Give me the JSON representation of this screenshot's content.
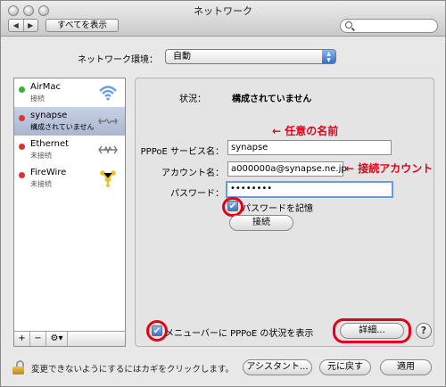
{
  "window": {
    "title": "ネットワーク",
    "nav_back": "◀",
    "nav_forward": "▶",
    "show_all": "すべてを表示",
    "search_placeholder": ""
  },
  "location": {
    "label": "ネットワーク環境：",
    "value": "自動"
  },
  "services": [
    {
      "name": "AirMac",
      "status": "接続",
      "status_color": "#2fb52f",
      "icon": "wifi-icon"
    },
    {
      "name": "synapse",
      "status": "構成されていません",
      "status_color": "#e03030",
      "icon": "ppp-icon"
    },
    {
      "name": "Ethernet",
      "status": "未接続",
      "status_color": "#e03030",
      "icon": "ethernet-icon"
    },
    {
      "name": "FireWire",
      "status": "未接続",
      "status_color": "#e03030",
      "icon": "firewire-icon"
    }
  ],
  "sidebar_toolbar": {
    "add": "+",
    "remove": "−",
    "gear": "⚙▾"
  },
  "detail": {
    "status_label": "状況：",
    "status_value": "構成されていません",
    "service_name_label": "PPPoE サービス名：",
    "service_name_value": "synapse",
    "account_label": "アカウント名：",
    "account_value": "a000000a@synapse.ne.jp",
    "password_label": "パスワード：",
    "password_value": "••••••••",
    "remember_label": "パスワードを記憶",
    "connect_button": "接続",
    "menubar_label": "メニューバーに PPPoE の状況を表示",
    "advanced_button": "詳細...",
    "help_button": "?"
  },
  "annotations": {
    "service_name_note": "← 任意の名前",
    "account_note": "← 接続アカウント"
  },
  "footer": {
    "lock_text": "変更できないようにするにはカギをクリックします。",
    "assistant_button": "アシスタント...",
    "revert_button": "元に戻す",
    "apply_button": "適用"
  }
}
